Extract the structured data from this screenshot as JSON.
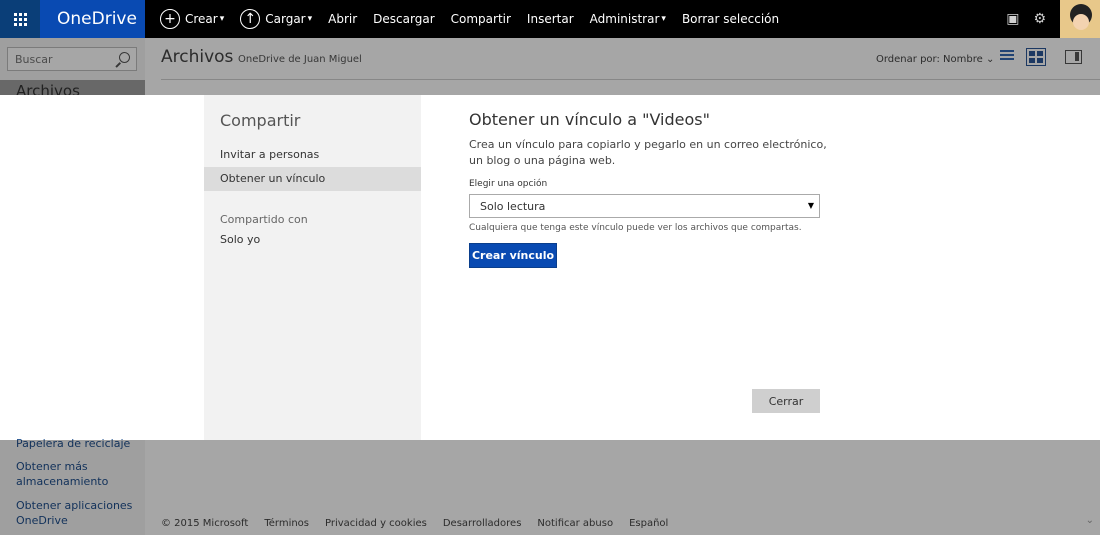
{
  "app": {
    "brand": "OneDrive"
  },
  "toolbar": {
    "items": [
      {
        "label": "Crear",
        "icon": "plus-icon",
        "dropdown": true
      },
      {
        "label": "Cargar",
        "icon": "upload-icon",
        "dropdown": true
      },
      {
        "label": "Abrir"
      },
      {
        "label": "Descargar"
      },
      {
        "label": "Compartir"
      },
      {
        "label": "Insertar"
      },
      {
        "label": "Administrar",
        "dropdown": true
      },
      {
        "label": "Borrar selección"
      }
    ]
  },
  "search": {
    "placeholder": "Buscar"
  },
  "sidebar": {
    "active": "Archivos",
    "links": [
      "Papelera de reciclaje",
      "Obtener más almacenamiento",
      "Obtener aplicaciones OneDrive"
    ]
  },
  "header": {
    "title": "Archivos",
    "subtitle": "OneDrive de Juan Miguel",
    "sort_label": "Ordenar por: Nombre"
  },
  "dialog": {
    "side_title": "Compartir",
    "side_items": [
      "Invitar a personas",
      "Obtener un vínculo"
    ],
    "active_item": "Obtener un vínculo",
    "shared_with_label": "Compartido con",
    "shared_with_value": "Solo yo",
    "title": "Obtener un vínculo a \"Videos\"",
    "description": "Crea un vínculo para copiarlo y pegarlo en un correo electrónico, un blog o una página web.",
    "option_label": "Elegir una opción",
    "option_value": "Solo lectura",
    "hint": "Cualquiera que tenga este vínculo puede ver los archivos que compartas.",
    "create_button": "Crear vínculo",
    "close_button": "Cerrar"
  },
  "footer": {
    "items": [
      "© 2015 Microsoft",
      "Términos",
      "Privacidad y cookies",
      "Desarrolladores",
      "Notificar abuso",
      "Español"
    ]
  },
  "colors": {
    "brand_blue": "#094ab2",
    "waffle_blue": "#0a3e78",
    "topbar": "#000000",
    "link_blue": "#1e4e8c"
  }
}
